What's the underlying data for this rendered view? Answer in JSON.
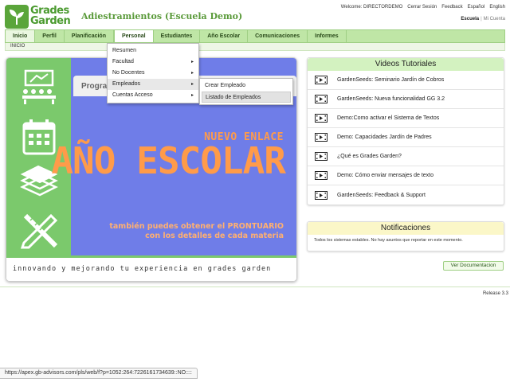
{
  "brand": {
    "line1": "Grades",
    "line2": "Garden",
    "accent": "#5aa53a"
  },
  "app_title": "Adiestramientos (Escuela Demo)",
  "top_links": [
    "Welcome: DIRECTORDEMO",
    "Cerrar Sesión",
    "Feedback",
    "Español",
    "English"
  ],
  "context_links": {
    "escuela": "Escuela",
    "mi_cuenta": "Mi Cuenta"
  },
  "nav": {
    "tabs": [
      "Inicio",
      "Perfil",
      "Planificación",
      "Personal",
      "Estudiantes",
      "Año Escolar",
      "Comunicaciones",
      "Informes"
    ],
    "active": "Inicio",
    "open": "Personal"
  },
  "breadcrumb": "INICIO",
  "personal_menu": [
    {
      "label": "Resumen",
      "has_sub": false
    },
    {
      "label": "Facultad",
      "has_sub": true
    },
    {
      "label": "No Docentes",
      "has_sub": true
    },
    {
      "label": "Empleados",
      "has_sub": true
    },
    {
      "label": "Cuentas Acceso",
      "has_sub": true
    }
  ],
  "empleados_submenu": [
    "Crear Empleado",
    "Listado de Empleados"
  ],
  "banner": {
    "tab_text": "Progra",
    "new_link": "NUEVO ENLACE",
    "headline": "AÑO ESCOLAR",
    "sub_line1": "también puedes obtener el PRONTUARIO",
    "sub_line2": "con los detalles de cada materia",
    "footer": "innovando y mejorando tu experiencia en grades garden",
    "colors": {
      "green": "#7bc96c",
      "blue": "#6f7de8",
      "orange": "#ff9b4a"
    }
  },
  "videos": {
    "title": "Videos Tutoriales",
    "items": [
      "GardenSeeds: Seminario Jardín de Cobros",
      "GardenSeeds: Nueva funcionalidad GG 3.2",
      "Demo:Como activar el Sistema de Textos",
      "Demo: Capacidades Jardín de Padres",
      "¿Qué es Grades Garden?",
      "Demo: Cómo enviar mensajes de texto",
      "GardenSeeds: Feedback & Support"
    ]
  },
  "notifications": {
    "title": "Notificaciones",
    "text": "Todos los sistemas estables. No hay asuntos que reportar en este momento."
  },
  "doc_button": "Ver Documentacion",
  "release": "Release 3.3",
  "status_url": "https://apex.gb-advisors.com/pls/web/f?p=1052:264:7226161734639::NO::::"
}
